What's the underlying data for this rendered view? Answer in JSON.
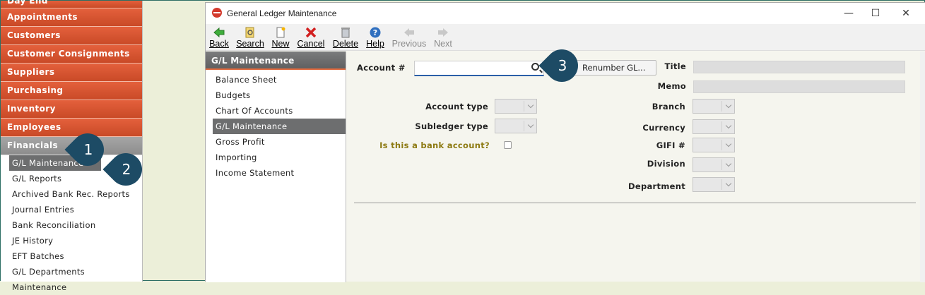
{
  "nav": {
    "categories": [
      "Day End",
      "Appointments",
      "Customers",
      "Customer Consignments",
      "Suppliers",
      "Purchasing",
      "Inventory",
      "Employees",
      "Financials"
    ],
    "financials_items": [
      "G/L Maintenance",
      "G/L Reports",
      "Archived Bank Rec. Reports",
      "Journal Entries",
      "Bank Reconciliation",
      "JE History",
      "EFT Batches",
      "G/L Departments Maintenance"
    ]
  },
  "window": {
    "title": "General Ledger Maintenance",
    "minimize": "—",
    "maximize": "☐",
    "close": "✕"
  },
  "toolbar": {
    "back": "Back",
    "search": "Search",
    "new": "New",
    "cancel": "Cancel",
    "delete": "Delete",
    "help": "Help",
    "previous": "Previous",
    "next": "Next"
  },
  "gl_panel": {
    "header": "G/L Maintenance",
    "items": [
      "Balance Sheet",
      "Budgets",
      "Chart Of Accounts",
      "G/L Maintenance",
      "Gross Profit",
      "Importing",
      "Income Statement"
    ]
  },
  "form": {
    "account_label": "Account #",
    "account_value": "",
    "renumber_label": "Renumber GL...",
    "account_type_label": "Account type",
    "subledger_type_label": "Subledger type",
    "bank_account_label": "Is this a bank account?",
    "title_label": "Title",
    "memo_label": "Memo",
    "branch_label": "Branch",
    "currency_label": "Currency",
    "gifi_label": "GIFI #",
    "division_label": "Division",
    "department_label": "Department"
  },
  "callouts": [
    "1",
    "2",
    "3"
  ],
  "colors": {
    "nav_orange": "#d4532f",
    "callout": "#1d4b65",
    "bank_label": "#8d7a12"
  }
}
